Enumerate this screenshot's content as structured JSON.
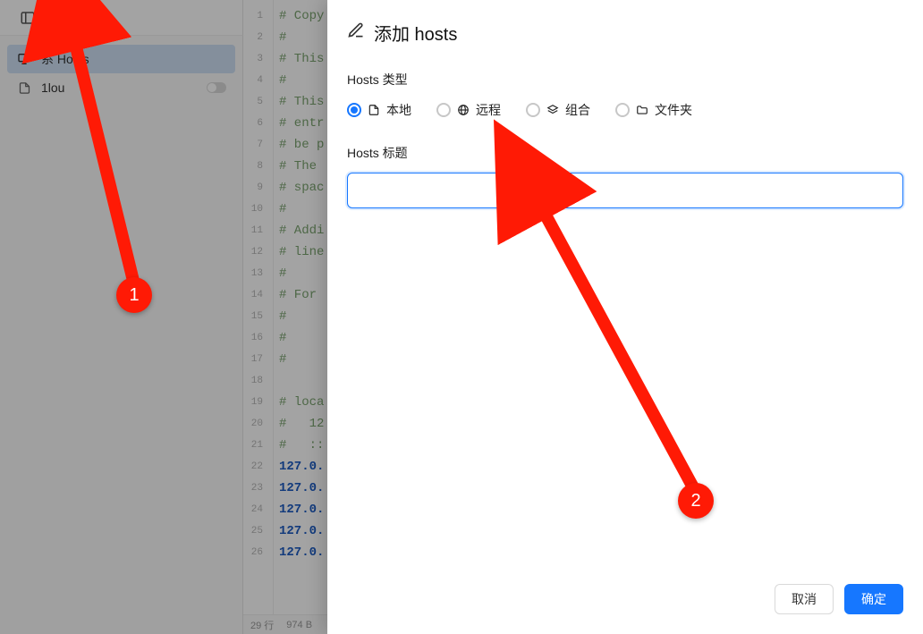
{
  "topbar": {
    "panel_icon": "panel-left-icon",
    "add_icon": "plus-icon"
  },
  "sidebar": {
    "items": [
      {
        "icon": "monitor-icon",
        "label": "系统 Hosts",
        "display_label": "系    Hosts",
        "selected": true,
        "has_toggle": false
      },
      {
        "icon": "file-icon",
        "label": "1lou",
        "selected": false,
        "has_toggle": true,
        "toggle_on": false
      }
    ]
  },
  "editor": {
    "lines": [
      {
        "n": 1,
        "text": "# Copy",
        "cls": "c-comment"
      },
      {
        "n": 2,
        "text": "#",
        "cls": "c-comment"
      },
      {
        "n": 3,
        "text": "# This",
        "cls": "c-comment"
      },
      {
        "n": 4,
        "text": "#",
        "cls": "c-comment"
      },
      {
        "n": 5,
        "text": "# This",
        "cls": "c-comment"
      },
      {
        "n": 6,
        "text": "# entr",
        "cls": "c-comment"
      },
      {
        "n": 7,
        "text": "# be p",
        "cls": "c-comment"
      },
      {
        "n": 8,
        "text": "# The",
        "cls": "c-comment"
      },
      {
        "n": 9,
        "text": "# spac",
        "cls": "c-comment"
      },
      {
        "n": 10,
        "text": "#",
        "cls": "c-comment"
      },
      {
        "n": 11,
        "text": "# Addi",
        "cls": "c-comment"
      },
      {
        "n": 12,
        "text": "# line",
        "cls": "c-comment"
      },
      {
        "n": 13,
        "text": "#",
        "cls": "c-comment"
      },
      {
        "n": 14,
        "text": "# For",
        "cls": "c-comment"
      },
      {
        "n": 15,
        "text": "#",
        "cls": "c-comment"
      },
      {
        "n": 16,
        "text": "#",
        "cls": "c-comment"
      },
      {
        "n": 17,
        "text": "#",
        "cls": "c-comment"
      },
      {
        "n": 18,
        "text": "",
        "cls": ""
      },
      {
        "n": 19,
        "text": "# loca",
        "cls": "c-comment"
      },
      {
        "n": 20,
        "text": "#   12",
        "cls": "c-comment"
      },
      {
        "n": 21,
        "text": "#   ::",
        "cls": "c-comment"
      },
      {
        "n": 22,
        "text": "127.0.",
        "cls": "c-ip"
      },
      {
        "n": 23,
        "text": "127.0.",
        "cls": "c-ip"
      },
      {
        "n": 24,
        "text": "127.0.",
        "cls": "c-ip"
      },
      {
        "n": 25,
        "text": "127.0.",
        "cls": "c-ip"
      },
      {
        "n": 26,
        "text": "127.0.",
        "cls": "c-ip"
      }
    ],
    "status_lines": "29 行",
    "status_size": "974 B"
  },
  "drawer": {
    "title": "添加 hosts",
    "type_label": "Hosts 类型",
    "options": [
      {
        "key": "local",
        "label": "本地",
        "icon": "file-icon",
        "selected": true
      },
      {
        "key": "remote",
        "label": "远程",
        "icon": "globe-icon",
        "selected": false
      },
      {
        "key": "group",
        "label": "组合",
        "icon": "stack-icon",
        "selected": false
      },
      {
        "key": "folder",
        "label": "文件夹",
        "icon": "folder-icon",
        "selected": false
      }
    ],
    "title_field_label": "Hosts 标题",
    "title_value": "",
    "cancel_label": "取消",
    "ok_label": "确定"
  },
  "annotation": {
    "badge1": "1",
    "badge2": "2"
  }
}
